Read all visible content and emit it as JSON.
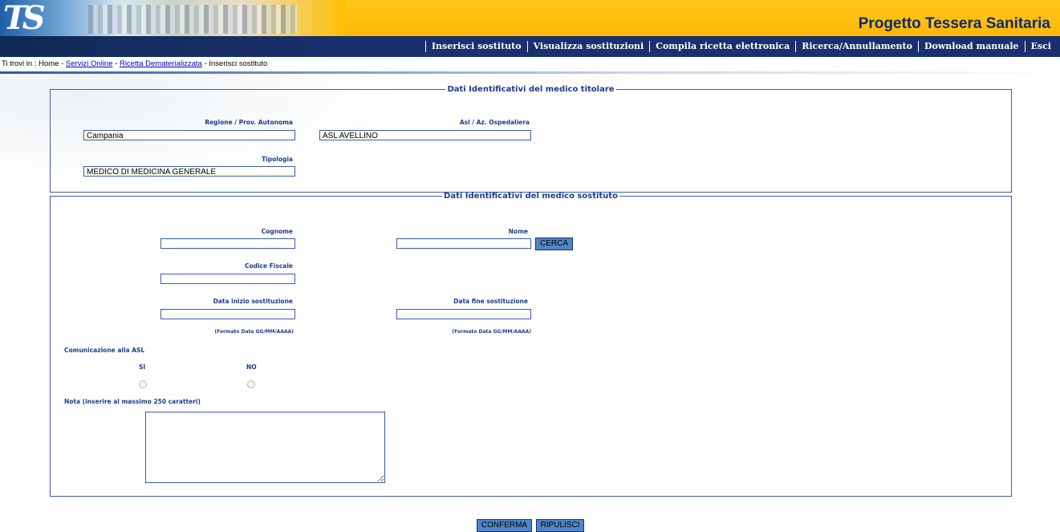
{
  "header": {
    "logo_text": "TS",
    "title": "Progetto Tessera Sanitaria"
  },
  "nav": {
    "items": [
      {
        "label": "Inserisci sostituto"
      },
      {
        "label": "Visualizza sostituzioni"
      },
      {
        "label": "Compila ricetta elettronica"
      },
      {
        "label": "Ricerca/Annullamento"
      },
      {
        "label": "Download manuale"
      },
      {
        "label": "Esci"
      }
    ]
  },
  "breadcrumb": {
    "prefix": "Ti trovi in : Home - ",
    "link1": "Servizi Online",
    "sep1": " - ",
    "link2": "Ricetta Dematerializzata",
    "sep2": " - ",
    "current": "Inserisci sostituto"
  },
  "titolare": {
    "legend": "Dati Identificativi del medico titolare",
    "regione_label": "Regione / Prov. Autonoma",
    "regione_value": "Campania",
    "asl_label": "Asl / Az. Ospedaliera",
    "asl_value": "ASL AVELLINO",
    "tipologia_label": "Tipologia",
    "tipologia_value": "MEDICO DI MEDICINA GENERALE"
  },
  "sostituto": {
    "legend": "Dati Identificativi del medico sostituto",
    "cognome_label": "Cognome",
    "nome_label": "Nome",
    "cerca_label": "CERCA",
    "codice_fiscale_label": "Codice Fiscale",
    "data_inizio_label": "Data inizio sostituzione",
    "data_fine_label": "Data fine sostituzione",
    "formato_inizio": "(Formato Data GG/MM/AAAA)",
    "formato_fine": "(Formato Data GG/MM/AAAA)",
    "comunicazione_label": "Comunicazione alla ASL",
    "si_label": "SI",
    "no_label": "NO",
    "nota_label": "Nota (inserire al massimo 250 caratteri)"
  },
  "actions": {
    "conferma_label": "CONFERMA",
    "ripulisci_label": "RIPULISCI"
  }
}
